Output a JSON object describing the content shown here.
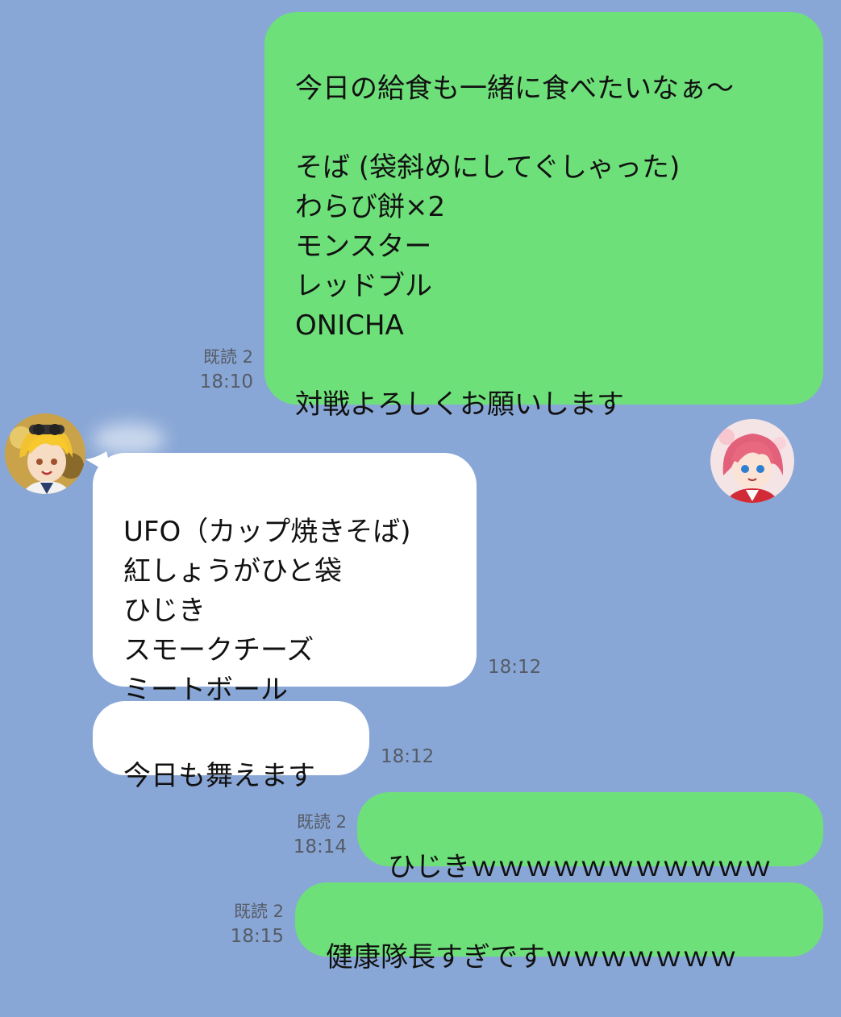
{
  "messages": [
    {
      "id": "m1",
      "side": "sent",
      "text": "今日の給食も一緒に食べたいなぁ〜\n\nそば (袋斜めにしてぐしゃった)\nわらび餅×2\nモンスター\nレッドブル\nONICHA\n\n対戦よろしくお願いします",
      "read_label": "既読 2",
      "time": "18:10"
    },
    {
      "id": "m2",
      "side": "received",
      "text": "UFO（カップ焼きそば)\n紅しょうがひと袋\nひじき\nスモークチーズ\nミートボール",
      "time": "18:12"
    },
    {
      "id": "m3",
      "side": "received",
      "text": "今日も舞えます",
      "time": "18:12"
    },
    {
      "id": "m4",
      "side": "sent",
      "text": "ひじきｗｗｗｗｗｗｗｗｗｗｗ",
      "read_label": "既読 2",
      "time": "18:14"
    },
    {
      "id": "m5",
      "side": "sent",
      "text": "健康隊長すぎですｗｗｗｗｗｗｗ",
      "read_label": "既読 2",
      "time": "18:15"
    }
  ],
  "avatars": {
    "contact": {
      "icon": "blonde-character-avatar-icon"
    },
    "self": {
      "icon": "pink-hair-character-avatar-icon"
    }
  },
  "colors": {
    "background": "#89a7d6",
    "sent_bubble": "#6ee07a",
    "received_bubble": "#ffffff",
    "meta_text": "#555b66"
  }
}
